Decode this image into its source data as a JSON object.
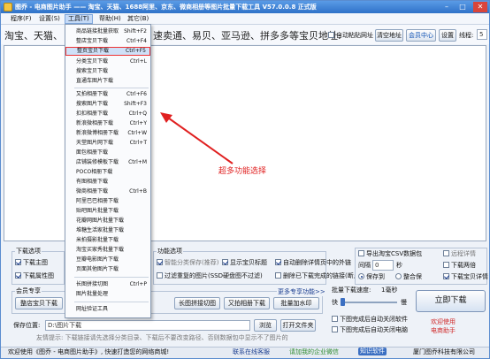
{
  "window": {
    "title": "图乔 - 电商图片助手 —— 淘宝、天猫、1688阿里、京东、微商相册等图片批量下载工具 V57.0.0.8 正式版",
    "minimize": "–",
    "maximize": "□",
    "close": "✕"
  },
  "menubar": {
    "items": [
      "程序(F)",
      "设置(S)",
      "工具(T)",
      "帮助(H)",
      "其它(B)"
    ]
  },
  "toolbar": {
    "banner_left": "淘宝、天猫、",
    "banner_right": "速卖通、易贝、亚马逊、拼多多等宝贝地址:",
    "auto_paste_label": "自动粘贴网址",
    "clear_button": "清空地址",
    "member_button": "会员中心",
    "settings_button": "设置",
    "threads_label": "线程:",
    "threads_value": "5"
  },
  "tools_menu": {
    "items": [
      {
        "label": "商品链接批量获取",
        "shortcut": "Shift+F2"
      },
      {
        "label": "整店宝贝下载",
        "shortcut": "Ctrl+F4"
      },
      {
        "label": "整页宝贝下载",
        "shortcut": "Ctrl+F5"
      },
      {
        "label": "分类宝贝下载",
        "shortcut": "Ctrl+L"
      },
      {
        "label": "搜索宝贝下载",
        "shortcut": ""
      },
      {
        "label": "直通车图片下载",
        "shortcut": ""
      },
      {
        "label": "又拍相册下载",
        "shortcut": "Ctrl+F6"
      },
      {
        "label": "搜索图片下载",
        "shortcut": "Shift+F3"
      },
      {
        "label": "扣扣相册下载",
        "shortcut": "Ctrl+Q"
      },
      {
        "label": "新浪微相册下载",
        "shortcut": "Ctrl+Y"
      },
      {
        "label": "新浪微博相册下载",
        "shortcut": "Ctrl+W"
      },
      {
        "label": "天堂图片网下载",
        "shortcut": "Ctrl+T"
      },
      {
        "label": "面包相册下载",
        "shortcut": ""
      },
      {
        "label": "店铺装修模板下载",
        "shortcut": "Ctrl+M"
      },
      {
        "label": "POCO相册下载",
        "shortcut": ""
      },
      {
        "label": "有图相册下载",
        "shortcut": ""
      },
      {
        "label": "微商相册下载",
        "shortcut": "Ctrl+B"
      },
      {
        "label": "阿里巴巴相册下载",
        "shortcut": ""
      },
      {
        "label": "贴吧图片批量下载",
        "shortcut": ""
      },
      {
        "label": "花瓣网图片批量下载",
        "shortcut": ""
      },
      {
        "label": "堆糖生活家批量下载",
        "shortcut": ""
      },
      {
        "label": "米拍摄影批量下载",
        "shortcut": ""
      },
      {
        "label": "淘宝买家秀批量下载",
        "shortcut": ""
      },
      {
        "label": "豆瓣电影图片下载",
        "shortcut": ""
      },
      {
        "label": "页面其他图片下载",
        "shortcut": ""
      },
      {
        "label": "长图拼接切图",
        "shortcut": "Ctrl+P"
      },
      {
        "label": "图片批量处理",
        "shortcut": ""
      },
      {
        "label": "网址验证工具",
        "shortcut": ""
      }
    ]
  },
  "annotation": "超多功能选择",
  "download_options": {
    "label": "下载选项",
    "main_images": "下载主图",
    "attr_images": "下载属性图"
  },
  "function_options": {
    "label": "功能选项",
    "smart_category": "智能分类保存(推荐)",
    "show_title": "显示宝贝标题",
    "auto_remove_links": "自动删除详情页中的外链",
    "filter_repeat": "过滤重复的图片(SSD硬盘图不过滤)",
    "remove_done_links": "删除已下载完成的链接(断点续传)"
  },
  "right_options": {
    "export_csv": "导出淘宝CSV数据包",
    "track_progress": "远程详情",
    "interval_label": "间隔",
    "interval_value": "0",
    "interval_unit": "秒",
    "range_label": "下载两倍",
    "save_mode_a": "保存到",
    "save_mode_b": "整合保",
    "download_detail": "下载宝贝详情"
  },
  "member": {
    "label": "会员专享",
    "more": "更多专享功能>>",
    "buttons": [
      "整店宝贝下载",
      "长图拼接切图",
      "又拍相册下载",
      "批量加水印"
    ]
  },
  "batch_speed": {
    "label": "批量下载速度:",
    "value": "1毫秒",
    "fast": "快",
    "slow": "慢"
  },
  "start_button": "立即下载",
  "after_options": {
    "close_software": "下图完成后自动关闭软件",
    "shutdown": "下图完成后自动关闭电脑"
  },
  "save_path": {
    "label": "保存位置:",
    "value": "D:\\图片下载",
    "browse": "浏览",
    "open": "打开文件夹"
  },
  "tip": "友情提示: 下载链接请先选择分类目录、下载后不要改变路径、否则数据包中显示不了图片的",
  "welcome": "欢迎使用\n电商助手",
  "statusbar": {
    "left": "欢迎使用《图乔 - 电商图片助手》, 快速打造您的网络商城!",
    "support": "联系在线客服",
    "wechat": "请加我的企业微信",
    "badge": "知识软件",
    "company": "厦门图乔科技有限公司"
  }
}
